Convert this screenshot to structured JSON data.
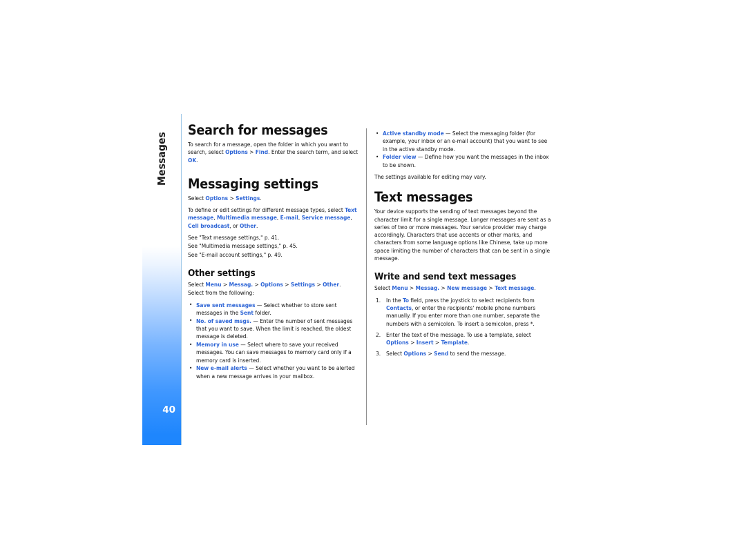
{
  "page": {
    "number": "40",
    "chapter": "Messages",
    "accent_blue": "#2f66d6",
    "spine_blue": "#1e86fd",
    "rule_blue": "#9fc8e8"
  },
  "left_column": {
    "heading_search": "Search for messages",
    "search_paragraph": {
      "part1": "To search for a message, open the folder in which you want to search, select ",
      "ui1": "Options",
      "sep1": " > ",
      "ui2": "Find",
      "part2": ". Enter the search term, and select ",
      "ui3": "OK",
      "part3": "."
    },
    "heading_messaging_settings": "Messaging settings",
    "select_line": {
      "prefix": "Select ",
      "ui1": "Options",
      "sep1": " > ",
      "ui2": "Settings",
      "suffix": "."
    },
    "define_paragraph": {
      "part1": "To define or edit settings for different message types, select ",
      "ui1": "Text message",
      "c1": ", ",
      "ui2": "Multimedia message",
      "c2": ", ",
      "ui3": "E-mail",
      "c3": ", ",
      "ui4": "Service message",
      "c4": ", ",
      "ui5": "Cell broadcast",
      "c5": ", or ",
      "ui6": "Other",
      "part2": "."
    },
    "see_refs": [
      "See \"Text message settings,\" p. 41.",
      "See \"Multimedia message settings,\" p. 45.",
      "See \"E-mail account settings,\" p. 49."
    ],
    "heading_other_settings": "Other settings",
    "other_select_line": {
      "prefix": "Select ",
      "ui1": "Menu",
      "s1": " > ",
      "ui2": "Messag.",
      "s2": " > ",
      "ui3": "Options",
      "s3": " > ",
      "ui4": "Settings",
      "s4": " > ",
      "ui5": "Other",
      "suffix": "."
    },
    "select_from_following": "Select from the following:",
    "settings_bullets": [
      {
        "term": "Save sent messages",
        "dash": " — ",
        "text1": "Select whether to store sent messages in the ",
        "ui_inline": "Sent",
        "text2": " folder."
      },
      {
        "term": "No. of saved msgs.",
        "dash": " — ",
        "text1": "Enter the number of sent messages that you want to save. When the limit is reached, the oldest message is deleted.",
        "ui_inline": "",
        "text2": ""
      },
      {
        "term": "Memory in use",
        "dash": " — ",
        "text1": "Select where to save your received messages. You can save messages to memory card only if a memory card is inserted.",
        "ui_inline": "",
        "text2": ""
      },
      {
        "term": "New e-mail alerts",
        "dash": " — ",
        "text1": "Select whether you want to be alerted when a new message arrives in your mailbox.",
        "ui_inline": "",
        "text2": ""
      }
    ]
  },
  "right_column": {
    "settings_bullets": [
      {
        "term": "Active standby mode",
        "dash": " — ",
        "text1": "Select the messaging folder (for example, your inbox or an e-mail account) that you want to see in the active standby mode."
      },
      {
        "term": "Folder view",
        "dash": " — ",
        "text1": "Define how you want the messages in the inbox to be shown."
      }
    ],
    "settings_note": "The settings available for editing may vary.",
    "heading_text_messages": "Text messages",
    "text_messages_paragraph": "Your device supports the sending of text messages beyond the character limit for a single message. Longer messages are sent as a series of two or more messages. Your service provider may charge accordingly. Characters that use accents or other marks, and characters from some language options like Chinese, take up more space limiting the number of characters that can be sent in a single message.",
    "heading_write_send": "Write and send text messages",
    "write_select_line": {
      "prefix": "Select ",
      "ui1": "Menu",
      "s1": " > ",
      "ui2": "Messag.",
      "s2": " > ",
      "ui3": "New message",
      "s3": " > ",
      "ui4": "Text message",
      "suffix": "."
    },
    "steps": [
      {
        "part1": "In the ",
        "ui1": "To",
        "part2": " field, press the joystick to select recipients from ",
        "ui2": "Contacts",
        "part3": ", or enter the recipients' mobile phone numbers manually. If you enter more than one number, separate the numbers with a semicolon. To insert a semicolon, press *.",
        "ui3": "",
        "part4": ""
      },
      {
        "part1": "Enter the text of the message. To use a template, select ",
        "ui1": "Options",
        "part2": " > ",
        "ui2": "Insert",
        "part3": " > ",
        "ui3": "Template",
        "part4": "."
      },
      {
        "part1": "Select ",
        "ui1": "Options",
        "part2": " > ",
        "ui2": "Send",
        "part3": " to send the message.",
        "ui3": "",
        "part4": ""
      }
    ]
  }
}
